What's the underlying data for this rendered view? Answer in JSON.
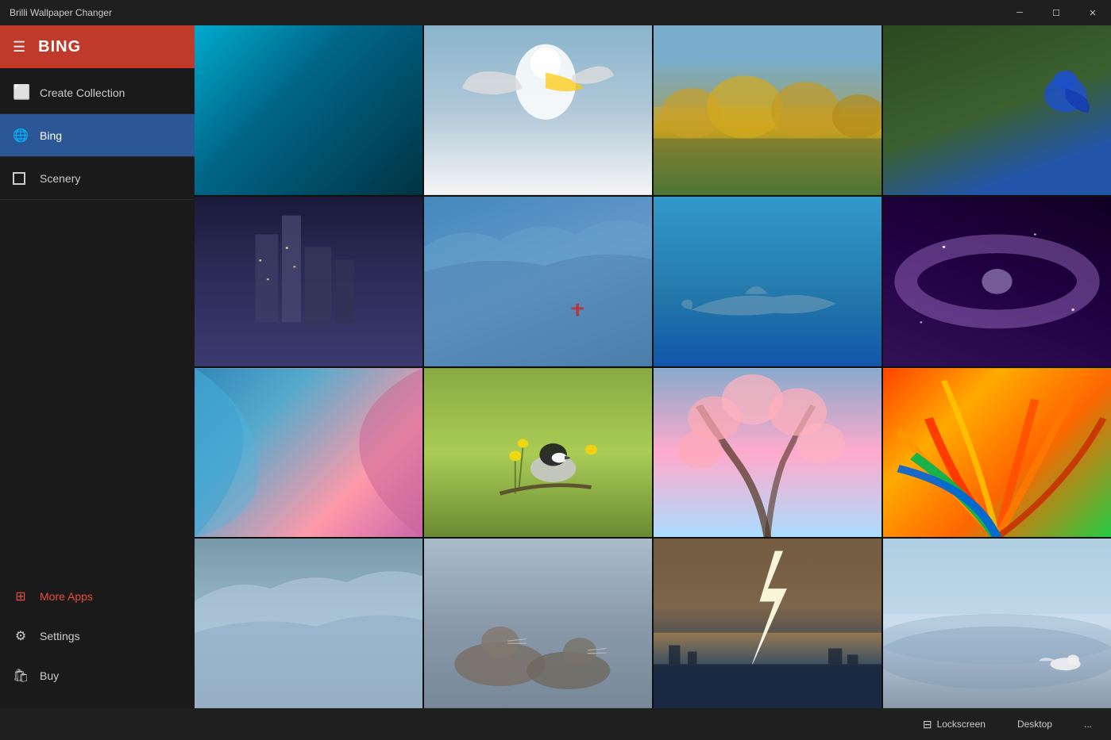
{
  "titlebar": {
    "title": "Brilli Wallpaper Changer",
    "minimize_label": "─",
    "maximize_label": "☐",
    "close_label": "✕"
  },
  "sidebar": {
    "brand": "BING",
    "nav_items": [
      {
        "id": "create-collection",
        "label": "Create Collection",
        "icon": "collection"
      },
      {
        "id": "bing",
        "label": "Bing",
        "icon": "globe",
        "active": true
      },
      {
        "id": "scenery",
        "label": "Scenery",
        "icon": "square"
      }
    ],
    "bottom_items": [
      {
        "id": "more-apps",
        "label": "More Apps",
        "icon": "grid",
        "accent": true
      },
      {
        "id": "settings",
        "label": "Settings",
        "icon": "gear"
      },
      {
        "id": "buy",
        "label": "Buy",
        "icon": "bag"
      }
    ]
  },
  "gallery": {
    "images": [
      {
        "id": "ocean",
        "class": "img-ocean",
        "alt": "Ocean wave"
      },
      {
        "id": "pelican",
        "class": "img-pelican",
        "alt": "Pelican in flight"
      },
      {
        "id": "autumn",
        "class": "img-autumn",
        "alt": "Autumn trees with horses"
      },
      {
        "id": "bluebird",
        "class": "img-bluebird",
        "alt": "Blue bird on branch"
      },
      {
        "id": "citynight",
        "class": "img-citynight",
        "alt": "City at night"
      },
      {
        "id": "glacier",
        "class": "img-glacier",
        "alt": "Glacier ice"
      },
      {
        "id": "dolphin",
        "class": "img-dolphin",
        "alt": "Dolphin underwater"
      },
      {
        "id": "galaxy",
        "class": "img-galaxy",
        "alt": "Galaxy nebula"
      },
      {
        "id": "abstract",
        "class": "img-abstract",
        "alt": "Abstract colorful art"
      },
      {
        "id": "chickadee",
        "class": "img-chickadee",
        "alt": "Chickadee bird on branch"
      },
      {
        "id": "cherry",
        "class": "img-cherry",
        "alt": "Cherry blossom tree"
      },
      {
        "id": "feathers",
        "class": "img-feathers",
        "alt": "Colorful feathers"
      },
      {
        "id": "icerock",
        "class": "img-icerock",
        "alt": "Ice and rock"
      },
      {
        "id": "seals",
        "class": "img-seals",
        "alt": "Seals on beach"
      },
      {
        "id": "lightning",
        "class": "img-lightning",
        "alt": "Lightning over city"
      },
      {
        "id": "misty",
        "class": "img-misty",
        "alt": "Misty seascape with bird"
      }
    ]
  },
  "footer": {
    "lockscreen_label": "Lockscreen",
    "desktop_label": "Desktop",
    "more_label": "..."
  }
}
